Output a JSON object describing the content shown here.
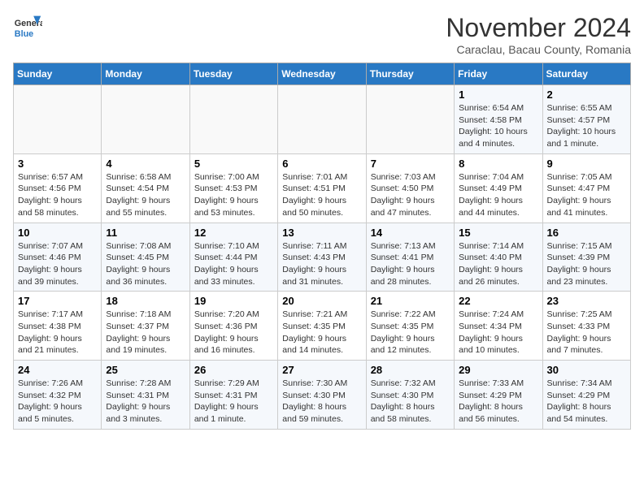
{
  "logo": {
    "line1": "General",
    "line2": "Blue"
  },
  "title": "November 2024",
  "subtitle": "Caraclau, Bacau County, Romania",
  "weekdays": [
    "Sunday",
    "Monday",
    "Tuesday",
    "Wednesday",
    "Thursday",
    "Friday",
    "Saturday"
  ],
  "weeks": [
    [
      {
        "day": "",
        "info": ""
      },
      {
        "day": "",
        "info": ""
      },
      {
        "day": "",
        "info": ""
      },
      {
        "day": "",
        "info": ""
      },
      {
        "day": "",
        "info": ""
      },
      {
        "day": "1",
        "info": "Sunrise: 6:54 AM\nSunset: 4:58 PM\nDaylight: 10 hours and 4 minutes."
      },
      {
        "day": "2",
        "info": "Sunrise: 6:55 AM\nSunset: 4:57 PM\nDaylight: 10 hours and 1 minute."
      }
    ],
    [
      {
        "day": "3",
        "info": "Sunrise: 6:57 AM\nSunset: 4:56 PM\nDaylight: 9 hours and 58 minutes."
      },
      {
        "day": "4",
        "info": "Sunrise: 6:58 AM\nSunset: 4:54 PM\nDaylight: 9 hours and 55 minutes."
      },
      {
        "day": "5",
        "info": "Sunrise: 7:00 AM\nSunset: 4:53 PM\nDaylight: 9 hours and 53 minutes."
      },
      {
        "day": "6",
        "info": "Sunrise: 7:01 AM\nSunset: 4:51 PM\nDaylight: 9 hours and 50 minutes."
      },
      {
        "day": "7",
        "info": "Sunrise: 7:03 AM\nSunset: 4:50 PM\nDaylight: 9 hours and 47 minutes."
      },
      {
        "day": "8",
        "info": "Sunrise: 7:04 AM\nSunset: 4:49 PM\nDaylight: 9 hours and 44 minutes."
      },
      {
        "day": "9",
        "info": "Sunrise: 7:05 AM\nSunset: 4:47 PM\nDaylight: 9 hours and 41 minutes."
      }
    ],
    [
      {
        "day": "10",
        "info": "Sunrise: 7:07 AM\nSunset: 4:46 PM\nDaylight: 9 hours and 39 minutes."
      },
      {
        "day": "11",
        "info": "Sunrise: 7:08 AM\nSunset: 4:45 PM\nDaylight: 9 hours and 36 minutes."
      },
      {
        "day": "12",
        "info": "Sunrise: 7:10 AM\nSunset: 4:44 PM\nDaylight: 9 hours and 33 minutes."
      },
      {
        "day": "13",
        "info": "Sunrise: 7:11 AM\nSunset: 4:43 PM\nDaylight: 9 hours and 31 minutes."
      },
      {
        "day": "14",
        "info": "Sunrise: 7:13 AM\nSunset: 4:41 PM\nDaylight: 9 hours and 28 minutes."
      },
      {
        "day": "15",
        "info": "Sunrise: 7:14 AM\nSunset: 4:40 PM\nDaylight: 9 hours and 26 minutes."
      },
      {
        "day": "16",
        "info": "Sunrise: 7:15 AM\nSunset: 4:39 PM\nDaylight: 9 hours and 23 minutes."
      }
    ],
    [
      {
        "day": "17",
        "info": "Sunrise: 7:17 AM\nSunset: 4:38 PM\nDaylight: 9 hours and 21 minutes."
      },
      {
        "day": "18",
        "info": "Sunrise: 7:18 AM\nSunset: 4:37 PM\nDaylight: 9 hours and 19 minutes."
      },
      {
        "day": "19",
        "info": "Sunrise: 7:20 AM\nSunset: 4:36 PM\nDaylight: 9 hours and 16 minutes."
      },
      {
        "day": "20",
        "info": "Sunrise: 7:21 AM\nSunset: 4:35 PM\nDaylight: 9 hours and 14 minutes."
      },
      {
        "day": "21",
        "info": "Sunrise: 7:22 AM\nSunset: 4:35 PM\nDaylight: 9 hours and 12 minutes."
      },
      {
        "day": "22",
        "info": "Sunrise: 7:24 AM\nSunset: 4:34 PM\nDaylight: 9 hours and 10 minutes."
      },
      {
        "day": "23",
        "info": "Sunrise: 7:25 AM\nSunset: 4:33 PM\nDaylight: 9 hours and 7 minutes."
      }
    ],
    [
      {
        "day": "24",
        "info": "Sunrise: 7:26 AM\nSunset: 4:32 PM\nDaylight: 9 hours and 5 minutes."
      },
      {
        "day": "25",
        "info": "Sunrise: 7:28 AM\nSunset: 4:31 PM\nDaylight: 9 hours and 3 minutes."
      },
      {
        "day": "26",
        "info": "Sunrise: 7:29 AM\nSunset: 4:31 PM\nDaylight: 9 hours and 1 minute."
      },
      {
        "day": "27",
        "info": "Sunrise: 7:30 AM\nSunset: 4:30 PM\nDaylight: 8 hours and 59 minutes."
      },
      {
        "day": "28",
        "info": "Sunrise: 7:32 AM\nSunset: 4:30 PM\nDaylight: 8 hours and 58 minutes."
      },
      {
        "day": "29",
        "info": "Sunrise: 7:33 AM\nSunset: 4:29 PM\nDaylight: 8 hours and 56 minutes."
      },
      {
        "day": "30",
        "info": "Sunrise: 7:34 AM\nSunset: 4:29 PM\nDaylight: 8 hours and 54 minutes."
      }
    ]
  ]
}
